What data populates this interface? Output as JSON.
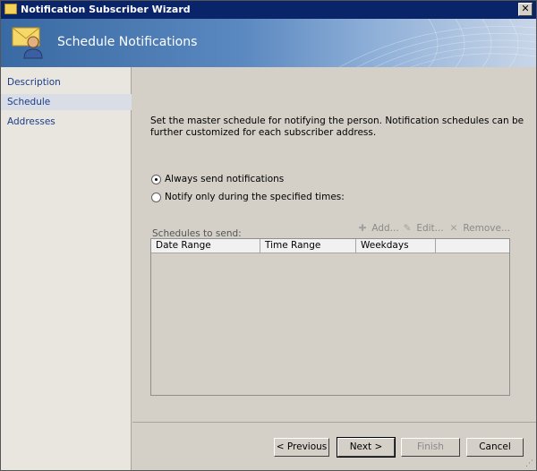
{
  "window": {
    "title": "Notification Subscriber Wizard",
    "close_glyph": "✕"
  },
  "banner": {
    "title": "Schedule Notifications",
    "icon": "user-mail-icon"
  },
  "nav": {
    "items": [
      {
        "label": "Description"
      },
      {
        "label": "Schedule",
        "active": true
      },
      {
        "label": "Addresses"
      }
    ]
  },
  "main": {
    "description": "Set the master schedule for notifying the person. Notification schedules can be further customized for each subscriber address.",
    "radio_always": "Always send notifications",
    "radio_specified": "Notify only during the specified times:",
    "schedules_label": "Schedules to send:",
    "toolbar": {
      "add": "Add...",
      "edit": "Edit...",
      "remove": "Remove..."
    },
    "grid_columns": [
      "Date Range",
      "Time Range",
      "Weekdays"
    ]
  },
  "buttons": {
    "previous": "< Previous",
    "next": "Next >",
    "finish": "Finish",
    "cancel": "Cancel"
  }
}
